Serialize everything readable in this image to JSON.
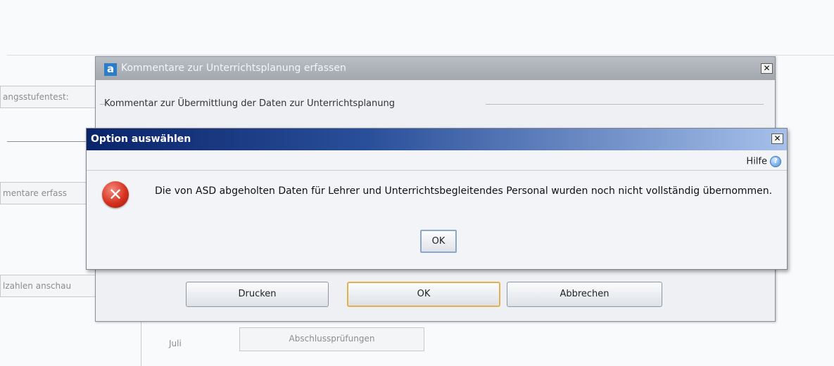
{
  "background": {
    "buttons": [
      {
        "label": "angsstufentest:"
      },
      {
        "label": "mentare erfass"
      },
      {
        "label": "lzahlen anschau"
      }
    ],
    "month_label": "Juli",
    "exam_button": "Abschlussprüfungen"
  },
  "comment_dialog": {
    "title": "Kommentare zur Unterrichtsplanung erfassen",
    "close_glyph": "✕",
    "group_label": "Kommentar zur Übermittlung der Daten zur Unterrichtsplanung",
    "buttons": {
      "print": "Drucken",
      "ok": "OK",
      "cancel": "Abbrechen"
    }
  },
  "option_dialog": {
    "title": "Option auswählen",
    "close_glyph": "✕",
    "help_label": "Hilfe",
    "message": "Die von ASD abgeholten Daten für Lehrer und Unterrichtsbegleitendes Personal wurden noch nicht vollständig übernommen.",
    "ok_label": "OK"
  },
  "icons": {
    "app_logo": "a",
    "error": "✕",
    "help": "?"
  }
}
